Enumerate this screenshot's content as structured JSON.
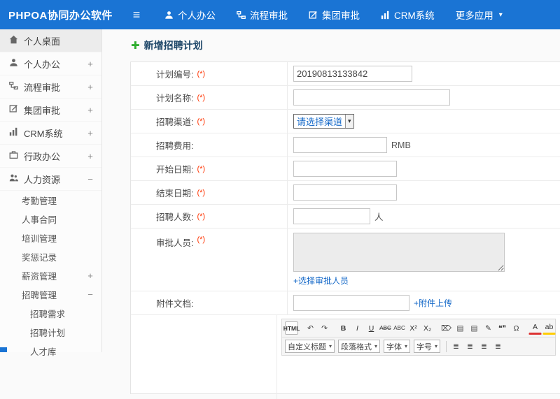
{
  "topbar": {
    "brand": "PHPOA协同办公软件",
    "menu_icon": "≡",
    "nav": [
      {
        "label": "个人办公"
      },
      {
        "label": "流程审批"
      },
      {
        "label": "集团审批"
      },
      {
        "label": "CRM系统"
      },
      {
        "label": "更多应用"
      }
    ],
    "more_caret": "▾"
  },
  "sidebar": {
    "top_items": [
      {
        "label": "个人桌面",
        "toggle": ""
      },
      {
        "label": "个人办公",
        "toggle": "+"
      },
      {
        "label": "流程审批",
        "toggle": "+"
      },
      {
        "label": "集团审批",
        "toggle": "+"
      },
      {
        "label": "CRM系统",
        "toggle": "+"
      },
      {
        "label": "行政办公",
        "toggle": "+"
      },
      {
        "label": "人力资源",
        "toggle": "−"
      }
    ],
    "hr_items": [
      {
        "label": "考勤管理",
        "toggle": ""
      },
      {
        "label": "人事合同",
        "toggle": ""
      },
      {
        "label": "培训管理",
        "toggle": ""
      },
      {
        "label": "奖惩记录",
        "toggle": ""
      },
      {
        "label": "薪资管理",
        "toggle": "+"
      },
      {
        "label": "招聘管理",
        "toggle": "−"
      }
    ],
    "recruit_items": [
      {
        "label": "招聘需求"
      },
      {
        "label": "招聘计划"
      },
      {
        "label": "人才库"
      }
    ]
  },
  "main": {
    "page_title": "新增招聘计划",
    "plus_icon": "✚",
    "required_mark": "(*)",
    "form": {
      "plan_no_label": "计划编号:",
      "plan_no_value": "20190813133842",
      "plan_name_label": "计划名称:",
      "channel_label": "招聘渠道:",
      "channel_value": "请选择渠道",
      "channel_arrow": "▾",
      "fee_label": "招聘费用:",
      "fee_suffix": "RMB",
      "start_label": "开始日期:",
      "end_label": "结束日期:",
      "count_label": "招聘人数:",
      "count_suffix": "人",
      "approver_label": "审批人员:",
      "approver_link": "+选择审批人员",
      "attach_label": "附件文档:",
      "attach_link": "+附件上传"
    },
    "editor": {
      "buttons_row1": [
        "HTML",
        "↶",
        "↷",
        "B",
        "I",
        "U",
        "ABC",
        "ABC",
        "X²",
        "X₂",
        "⌦",
        "▤",
        "▤",
        "✎",
        "❝❞",
        "Ω",
        "A",
        "ab"
      ],
      "dropdowns": [
        "自定义标题",
        "段落格式",
        "字体",
        "字号"
      ],
      "dropdown_arrow": "▾",
      "align_glyph": "≣"
    }
  }
}
